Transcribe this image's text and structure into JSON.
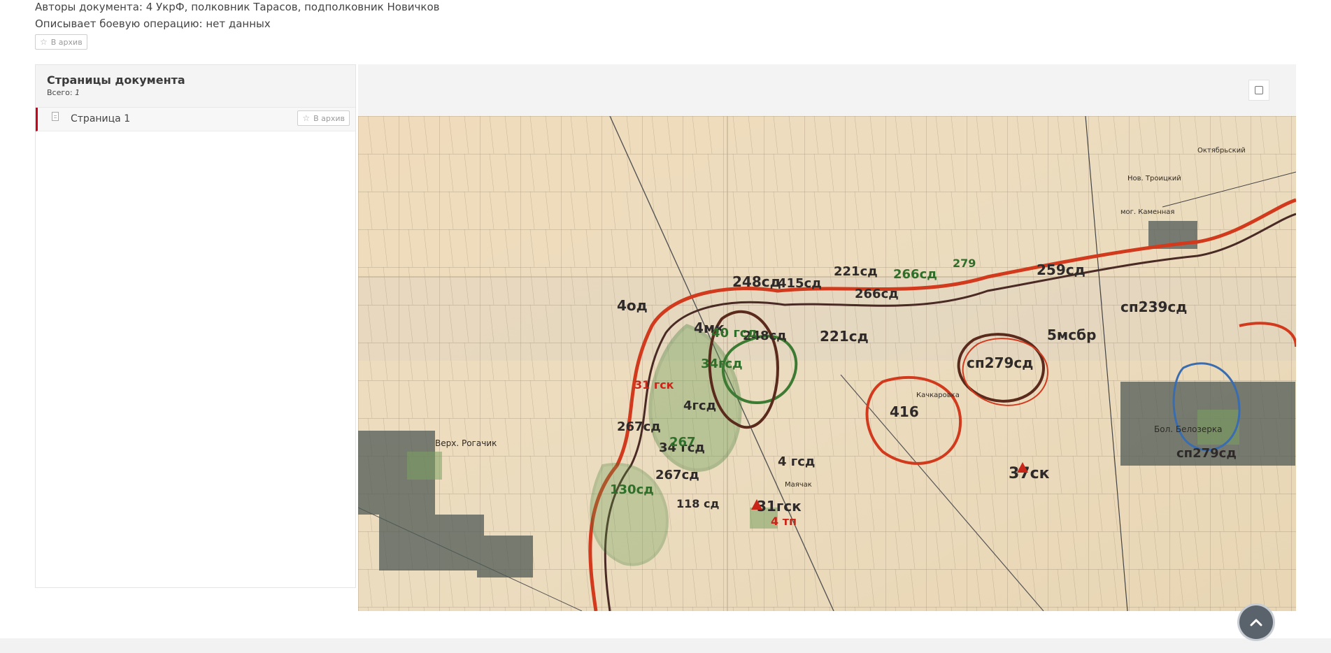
{
  "document": {
    "authors": "Авторы документа: 4 УкрФ, полковник Тарасов, подполковник Новичков",
    "operation": "Описывает боевую операцию: нет данных",
    "archive_label": "В архив"
  },
  "pages_panel": {
    "title": "Страницы документа",
    "count_label": "Всего:",
    "count_value": "1",
    "items": [
      {
        "label": "Страница 1",
        "archive_label": "В архив"
      }
    ]
  },
  "map": {
    "labels": {
      "rogachik": "Верх. Рогачик",
      "belozerka": "Бол. Белозерка",
      "kachkarovka": "Качкаровка",
      "maychak": "Маячак",
      "oktyabrsky": "Октябрьский",
      "kamennaya": "мог. Каменная",
      "troitsky": "Нов. Троицкий",
      "n4od": "4од",
      "n248": "248сд",
      "n415": "415сд",
      "n221": "221сд",
      "n266a": "266сд",
      "n279a": "279",
      "n259": "259сд",
      "n266b": "266сд",
      "n239": "сп239сд",
      "n40": "40 гсд",
      "n4mk": "4мк",
      "n248b": "248сд",
      "n221b": "221сд",
      "n5msbr": "5мсбр",
      "n279b": "сп279сд",
      "n34": "34гсд",
      "n31": "31 гск",
      "n4gsd": "4гсд",
      "n267": "267сд",
      "n267b": "267",
      "n34b": "34 гсд",
      "n416": "416",
      "n4gsd2": "4 гсд",
      "n37ck": "37ск",
      "n279c": "сп279сд",
      "n130": "130сд",
      "n267c": "267сд",
      "n118": "118 сд",
      "n31gck": "31гск",
      "n4tp": "4 тп"
    }
  }
}
